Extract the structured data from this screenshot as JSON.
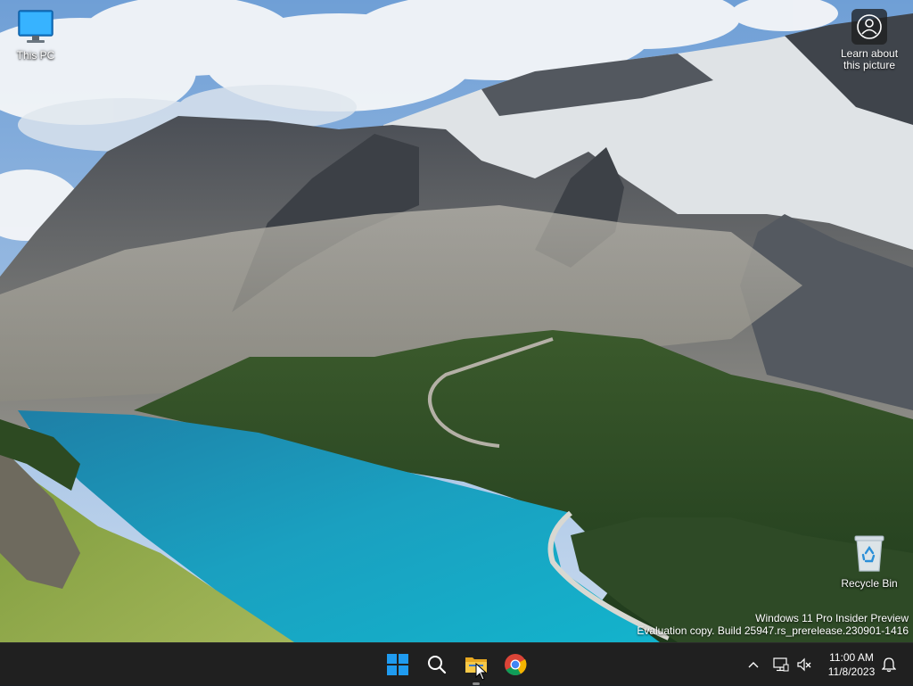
{
  "desktop": {
    "icons": [
      {
        "label": "This PC",
        "icon": "monitor-icon"
      },
      {
        "label": "Recycle Bin",
        "icon": "recycle-bin-icon"
      }
    ],
    "spotlight": {
      "label": "Learn about this picture",
      "icon": "camera-circle-icon"
    },
    "wallpaper": "mountain-lake-landscape"
  },
  "watermark": {
    "line1": "Windows 11 Pro Insider Preview",
    "line2": "Evaluation copy. Build 25947.rs_prerelease.230901-1416"
  },
  "taskbar": {
    "pinned": [
      {
        "name": "Start",
        "icon": "windows-logo-icon"
      },
      {
        "name": "Search",
        "icon": "search-icon"
      },
      {
        "name": "File Explorer",
        "icon": "folder-icon",
        "running": true
      },
      {
        "name": "Google Chrome",
        "icon": "chrome-icon"
      }
    ],
    "tray": {
      "time": "11:00 AM",
      "date": "11/8/2023"
    },
    "colors": {
      "background": "#202020",
      "accent": "#0078d4"
    }
  }
}
